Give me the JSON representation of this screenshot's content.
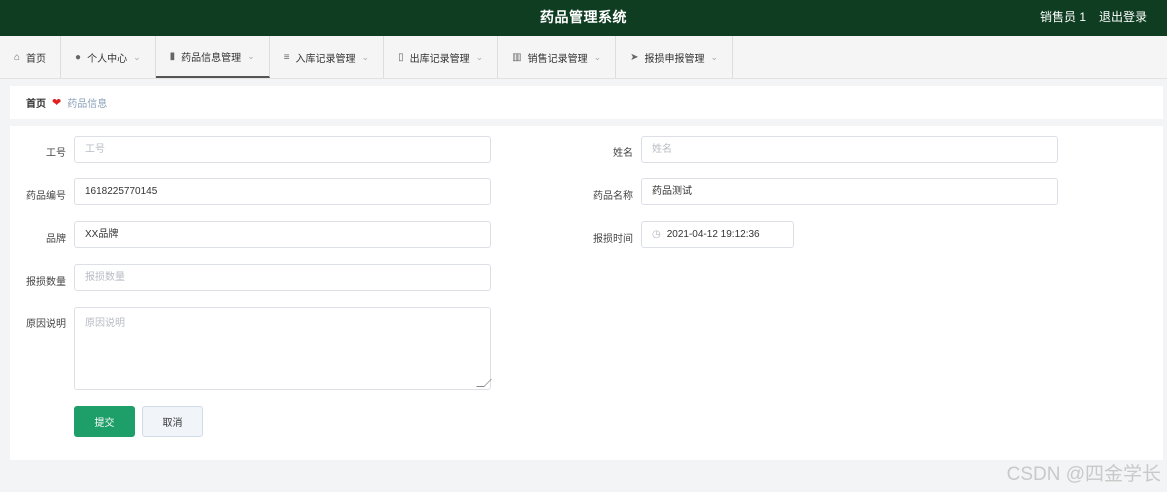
{
  "header": {
    "title": "药品管理系统",
    "user": "销售员 1",
    "logout": "退出登录"
  },
  "nav": {
    "items": [
      {
        "icon": "house-icon",
        "glyph": "⌂",
        "label": "首页",
        "dropdown": false
      },
      {
        "icon": "user-icon",
        "glyph": "●",
        "label": "个人中心",
        "dropdown": true
      },
      {
        "icon": "pill-icon",
        "glyph": "▮",
        "label": "药品信息管理",
        "dropdown": true,
        "active": true
      },
      {
        "icon": "list-icon",
        "glyph": "≡",
        "label": "入库记录管理",
        "dropdown": true
      },
      {
        "icon": "clipboard-icon",
        "glyph": "▯",
        "label": "出库记录管理",
        "dropdown": true
      },
      {
        "icon": "bar-chart-icon",
        "glyph": "▥",
        "label": "销售记录管理",
        "dropdown": true
      },
      {
        "icon": "send-icon",
        "glyph": "➤",
        "label": "报损申报管理",
        "dropdown": true
      }
    ]
  },
  "breadcrumb": {
    "home": "首页",
    "separator_icon": "heart-icon",
    "current": "药品信息"
  },
  "form": {
    "employee_id": {
      "label": "工号",
      "value": "",
      "placeholder": "工号"
    },
    "name": {
      "label": "姓名",
      "value": "",
      "placeholder": "姓名"
    },
    "drug_code": {
      "label": "药品编号",
      "value": "1618225770145"
    },
    "drug_name": {
      "label": "药品名称",
      "value": "药品测试"
    },
    "brand": {
      "label": "品牌",
      "value": "XX品牌"
    },
    "report_time": {
      "label": "报损时间",
      "value": "2021-04-12 19:12:36"
    },
    "quantity": {
      "label": "报损数量",
      "value": "",
      "placeholder": "报损数量"
    },
    "reason": {
      "label": "原因说明",
      "value": "",
      "placeholder": "原因说明"
    }
  },
  "buttons": {
    "submit": "提交",
    "cancel": "取消"
  },
  "watermark": "CSDN @四金学长",
  "colors": {
    "header_bg": "#0f3d22",
    "submit_bg": "#1e9e68",
    "heart": "#e02020"
  }
}
